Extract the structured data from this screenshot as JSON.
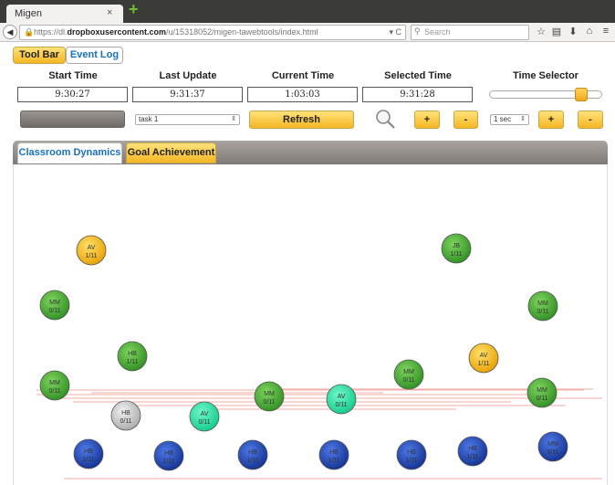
{
  "browser": {
    "tab_title": "Migen",
    "tab_close": "×",
    "new_tab": "+",
    "url_prefix": "https://dl.",
    "url_domain": "dropboxusercontent.com",
    "url_rest": "/u/15318052/migen-tawebtools/index.html",
    "reload_glyph": "▾ C",
    "search_placeholder": "Search"
  },
  "app_tabs": [
    {
      "label": "Tool Bar",
      "active": true
    },
    {
      "label": "Event Log",
      "active": false
    }
  ],
  "columns": {
    "start_time": {
      "label": "Start Time",
      "value": "9:30:27"
    },
    "last_update": {
      "label": "Last Update",
      "value": "9:31:37"
    },
    "current_time": {
      "label": "Current Time",
      "value": "1:03:03"
    },
    "selected_time": {
      "label": "Selected Time",
      "value": "9:31:28"
    },
    "time_selector": {
      "label": "Time Selector",
      "level_fraction": 0.88
    }
  },
  "controls": {
    "task_select": "task 1",
    "refresh_label": "Refresh",
    "plus_label": "+",
    "minus_label": "-",
    "interval_select": "1 sec"
  },
  "panel_tabs": [
    {
      "label": "Classroom Dynamics",
      "active": true
    },
    {
      "label": "Goal Achievement",
      "active": false
    }
  ],
  "colors": {
    "green": "#3aa62b",
    "yellow": "#f4b400",
    "blue": "#1c43b8",
    "grey": "#c9c9c9",
    "teal": "#22e6a6",
    "accent_link": "#1670c1"
  },
  "students": [
    {
      "initials": "AV",
      "score": "1/11",
      "color": "yellow"
    },
    {
      "initials": "JB",
      "score": "1/11",
      "color": "green"
    },
    {
      "initials": "MM",
      "score": "0/11",
      "color": "green"
    },
    {
      "initials": "MM",
      "score": "0/11",
      "color": "green"
    },
    {
      "initials": "HB",
      "score": "1/11",
      "color": "green"
    },
    {
      "initials": "AV",
      "score": "1/11",
      "color": "yellow"
    },
    {
      "initials": "MM",
      "score": "0/11",
      "color": "green"
    },
    {
      "initials": "MM",
      "score": "0/11",
      "color": "green"
    },
    {
      "initials": "HB",
      "score": "0/11",
      "color": "grey"
    },
    {
      "initials": "AV",
      "score": "0/11",
      "color": "teal"
    },
    {
      "initials": "MM",
      "score": "0/11",
      "color": "green"
    },
    {
      "initials": "AV",
      "score": "0/11",
      "color": "teal"
    },
    {
      "initials": "MM",
      "score": "0/11",
      "color": "green"
    },
    {
      "initials": "HB",
      "score": "1/11",
      "color": "blue"
    },
    {
      "initials": "HB",
      "score": "1/11",
      "color": "blue"
    },
    {
      "initials": "HB",
      "score": "1/11",
      "color": "blue"
    },
    {
      "initials": "HB",
      "score": "1/11",
      "color": "blue"
    },
    {
      "initials": "HB",
      "score": "1/11",
      "color": "blue"
    },
    {
      "initials": "HB",
      "score": "1/11",
      "color": "blue"
    },
    {
      "initials": "MM",
      "score": "0/11",
      "color": "blue"
    }
  ]
}
